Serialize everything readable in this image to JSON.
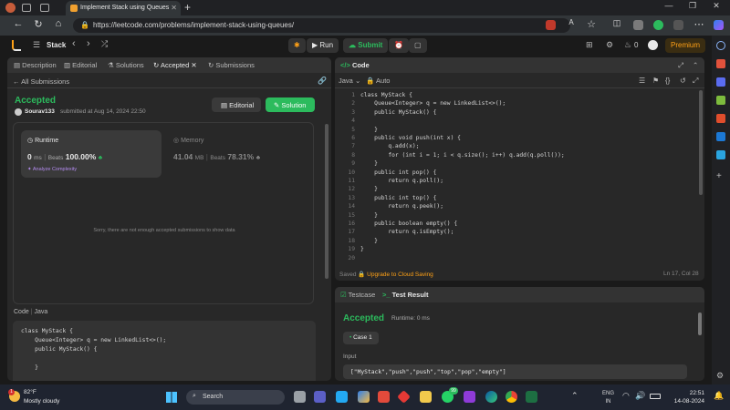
{
  "browser": {
    "tab_title": "Implement Stack using Queues",
    "url": "https://leetcode.com/problems/implement-stack-using-queues/",
    "new_tab": "+"
  },
  "header": {
    "problem_list": "Stack",
    "run": "Run",
    "submit": "Submit",
    "fire_count": "0",
    "premium": "Premium"
  },
  "left_tabs": {
    "description": "Description",
    "editorial": "Editorial",
    "solutions": "Solutions",
    "accepted": "Accepted",
    "submissions": "Submissions"
  },
  "submission": {
    "all_submissions": "All Submissions",
    "status": "Accepted",
    "user": "Sourav133",
    "submitted_at": "submitted at Aug 14, 2024 22:50",
    "editorial_btn": "Editorial",
    "solution_btn": "Solution",
    "runtime_label": "Runtime",
    "runtime_value": "0",
    "runtime_unit": "ms",
    "runtime_beats_label": "Beats",
    "runtime_beats": "100.00%",
    "analyze": "Analyze Complexity",
    "memory_label": "Memory",
    "memory_value": "41.04",
    "memory_unit": "MB",
    "memory_beats_label": "Beats",
    "memory_beats": "78.31%",
    "no_data": "Sorry, there are not enough accepted submissions to show data",
    "code_label": "Code",
    "code_lang": "Java",
    "preview": [
      "class MyStack {",
      "    Queue<Integer> q = new LinkedList<>();",
      "    public MyStack() {",
      "",
      "    }"
    ]
  },
  "editor": {
    "title": "Code",
    "lang": "Java",
    "mode": "Auto",
    "saved": "Saved",
    "upgrade": "Upgrade to Cloud Saving",
    "cursor": "Ln 17, Col 28",
    "line_numbers": [
      "1",
      "2",
      "3",
      "4",
      "5",
      "6",
      "7",
      "8",
      "9",
      "10",
      "11",
      "12",
      "13",
      "14",
      "15",
      "16",
      "17",
      "18",
      "19",
      "20"
    ],
    "lines": [
      "class MyStack {",
      "    Queue<Integer> q = new LinkedList<>();",
      "    public MyStack() {",
      "",
      "    }",
      "    public void push(int x) {",
      "        q.add(x);",
      "        for (int i = 1; i < q.size(); i++) q.add(q.poll());",
      "    }",
      "    public int pop() {",
      "        return q.poll();",
      "    }",
      "    public int top() {",
      "        return q.peek();",
      "    }",
      "    public boolean empty() {",
      "        return q.isEmpty();",
      "    }",
      "}",
      ""
    ]
  },
  "result": {
    "testcase_tab": "Testcase",
    "result_tab": "Test Result",
    "status": "Accepted",
    "runtime": "Runtime: 0 ms",
    "case": "Case 1",
    "input_label": "Input",
    "input_value": "[\"MyStack\",\"push\",\"push\",\"top\",\"pop\",\"empty\"]"
  },
  "taskbar": {
    "temp": "82°F",
    "weather": "Mostly cloudy",
    "search": "Search",
    "lang1": "ENG",
    "lang2": "IN",
    "time": "22:51",
    "date": "14-08-2024",
    "notif": "1",
    "badge_count": "99"
  },
  "colors": {
    "accent_green": "#2cbb5d",
    "accent_orange": "#ffa116",
    "panel_bg": "#282828"
  }
}
